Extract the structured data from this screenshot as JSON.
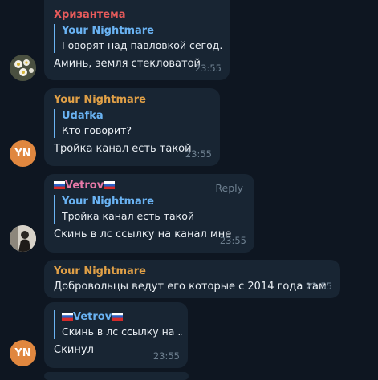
{
  "colors": {
    "background": "#0e1621",
    "bubble": "#182533",
    "accent": "#6ab3f3",
    "sender_red": "#e75b5b",
    "sender_orange": "#e0a047",
    "sender_pink": "#e779a8",
    "avatar_orange": "#e0873f"
  },
  "messages": [
    {
      "sender": "Хризантема",
      "reply_to": {
        "name": "Your Nightmare",
        "text": "Говорят над павловкой сегод..."
      },
      "text": "Аминь, земля стекловатой",
      "time": "23:55"
    },
    {
      "avatar_initials": "YN",
      "sender": "Your Nightmare",
      "reply_to": {
        "name": "Udafka",
        "text": "Кто говорит?"
      },
      "text": "Тройка канал есть такой",
      "time": "23:55"
    },
    {
      "sender": "Vetrov",
      "reply_label": "Reply",
      "reply_to": {
        "name": "Your Nightmare",
        "text": "Тройка канал есть такой"
      },
      "text": "Скинь в лс ссылку на канал мне",
      "time": "23:55"
    },
    {
      "sender": "Your Nightmare",
      "text": "Добровольцы ведут его которые с 2014 года там",
      "time": "23:55"
    },
    {
      "avatar_initials": "YN",
      "reply_to": {
        "name": "Vetrov",
        "text": "Скинь в лс ссылку на ..."
      },
      "text": "Скинул",
      "time": "23:55"
    }
  ]
}
